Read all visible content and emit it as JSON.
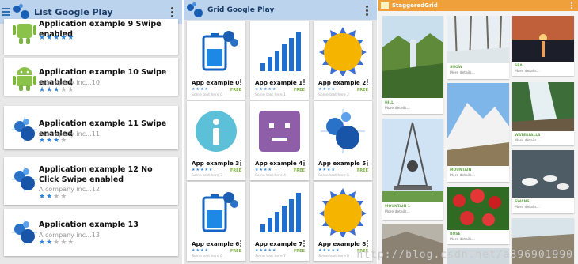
{
  "panel_list": {
    "title": "List Google Play",
    "items": [
      {
        "title": "Application example 9 Swipe enabled",
        "company": "A company inc...9",
        "icon": "android"
      },
      {
        "title": "Application example 10 Swipe enabled",
        "company": "A company inc...10",
        "icon": "android"
      },
      {
        "title": "Application example 11 Swipe enabled",
        "company": "A company inc...11",
        "icon": "bubbles"
      },
      {
        "title": "Application example 12 No Click Swipe enabled",
        "company": "A company inc...12",
        "icon": "bubbles"
      },
      {
        "title": "Application example 13",
        "company": "A company inc...13",
        "icon": "bubbles"
      }
    ]
  },
  "panel_grid": {
    "title": "Grid Google Play",
    "free_label": "FREE",
    "items": [
      {
        "name": "App example 0",
        "text": "Some text here 0",
        "icon": "battery"
      },
      {
        "name": "App example 1",
        "text": "Some text here 1",
        "icon": "signal"
      },
      {
        "name": "App example 2",
        "text": "Some text here 2",
        "icon": "sun"
      },
      {
        "name": "App example 3",
        "text": "Some text here 3",
        "icon": "info"
      },
      {
        "name": "App example 4",
        "text": "Some text here 4",
        "icon": "face"
      },
      {
        "name": "App example 5",
        "text": "Some text here 5",
        "icon": "bubbles"
      },
      {
        "name": "App example 6",
        "text": "Some text here 6",
        "icon": "battery"
      },
      {
        "name": "App example 7",
        "text": "Some text here 7",
        "icon": "signal"
      },
      {
        "name": "App example 8",
        "text": "Some text here 8",
        "icon": "sun"
      }
    ]
  },
  "panel_staggered": {
    "title": "StaggeredGrid",
    "more": "More details...",
    "tiles": [
      {
        "label": "HILL",
        "photo": "hill"
      },
      {
        "label": "SNOW",
        "photo": "snow"
      },
      {
        "label": "SEA",
        "photo": "sea"
      },
      {
        "label": "MOUNTAIN 1",
        "photo": "tower"
      },
      {
        "label": "MOUNTAIN",
        "photo": "mountain"
      },
      {
        "label": "WATERFALLS",
        "photo": "waterfall"
      },
      {
        "label": "SWANS",
        "photo": "swans"
      },
      {
        "label": "ROSE",
        "photo": "rose"
      },
      {
        "label": "",
        "photo": "rock"
      },
      {
        "label": "",
        "photo": "lake"
      },
      {
        "label": "",
        "photo": "cliff"
      }
    ]
  },
  "watermark": "http://blog.csdn.net/a396901990"
}
